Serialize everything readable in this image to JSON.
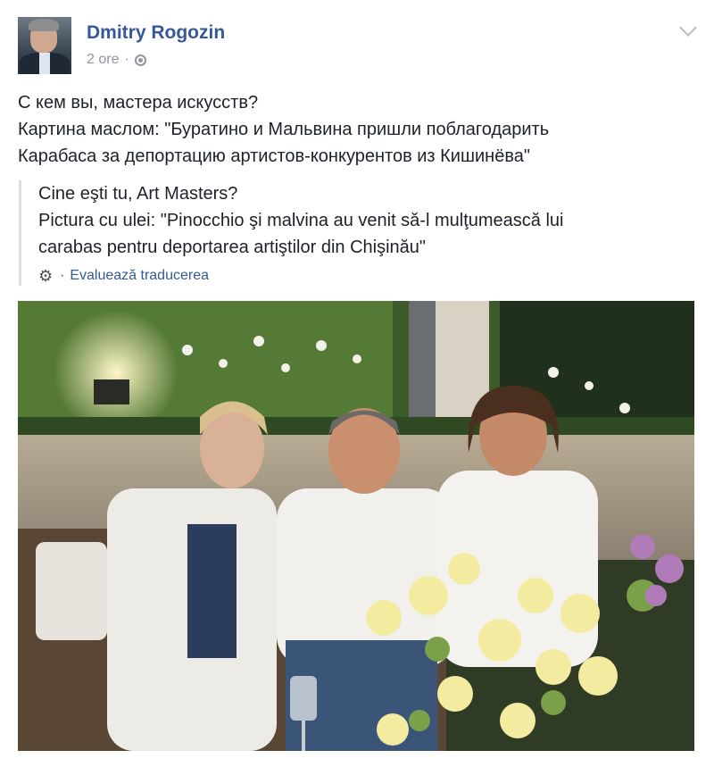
{
  "post": {
    "author": "Dmitry Rogozin",
    "time": "2 ore",
    "separator": "·",
    "text_lines": [
      "С кем вы, мастера искусств?",
      "Картина маслом: \"Буратино и Мальвина пришли поблагодарить",
      "Карабаса за депортацию артистов-конкурентов из Кишинёва\""
    ],
    "translation_lines": [
      "Cine eşti tu, Art Masters?",
      "Pictura cu ulei: \"Pinocchio şi malvina au venit să-l mulţumească lui",
      "carabas pentru deportarea artiştilor din Chişinău\""
    ],
    "rate_translation": "Evaluează traducerea",
    "icons": {
      "privacy": "globe-icon",
      "options": "chevron-down-icon",
      "settings": "gear-icon"
    }
  },
  "colors": {
    "author": "#365899",
    "meta": "#90949c",
    "text": "#1d2129"
  }
}
